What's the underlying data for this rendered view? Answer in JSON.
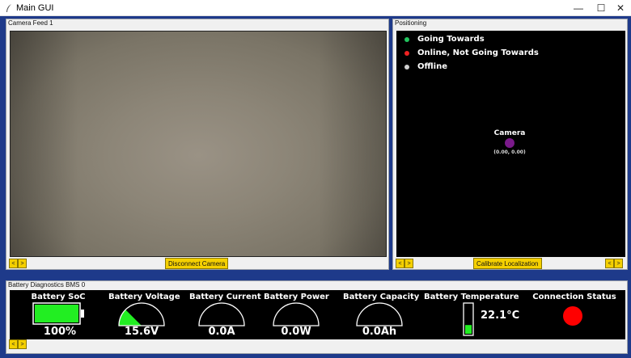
{
  "window": {
    "title": "Main GUI",
    "controls": {
      "minimize": "—",
      "maximize": "☐",
      "close": "✕"
    }
  },
  "camera_feed": {
    "label": "Camera Feed 1",
    "prev": "<",
    "next": ">",
    "disconnect_label": "Disconnect Camera"
  },
  "positioning": {
    "label": "Positioning",
    "legend": [
      {
        "label": "Going Towards",
        "color": "#22c55e"
      },
      {
        "label": "Online, Not Going Towards",
        "color": "#ef2222"
      },
      {
        "label": "Offline",
        "color": "#d0d0d0"
      }
    ],
    "marker": {
      "label": "Camera",
      "coords": "(0.00, 0.00)",
      "color": "#7a1a8a"
    },
    "prev": "<",
    "next": ">",
    "calibrate_label": "Calibrate Localization",
    "right_prev": "<",
    "right_next": ">"
  },
  "battery": {
    "label": "Battery Diagnostics BMS 0",
    "soc": {
      "title": "Battery SoC",
      "value": "100%",
      "level": 1.0
    },
    "voltage": {
      "title": "Battery Voltage",
      "value": "15.6V",
      "level": 0.25
    },
    "current": {
      "title": "Battery Current",
      "value": "0.0A",
      "level": 0.0
    },
    "power": {
      "title": "Battery Power",
      "value": "0.0W",
      "level": 0.0
    },
    "capacity": {
      "title": "Battery Capacity",
      "value": "0.0Ah",
      "level": 0.0
    },
    "temperature": {
      "title": "Battery Temperature",
      "value": "22.1°C",
      "level": 0.3
    },
    "connection": {
      "title": "Connection Status",
      "status_color": "#ff0000"
    },
    "prev": "<",
    "next": ">",
    "accent": "#22cc22"
  }
}
